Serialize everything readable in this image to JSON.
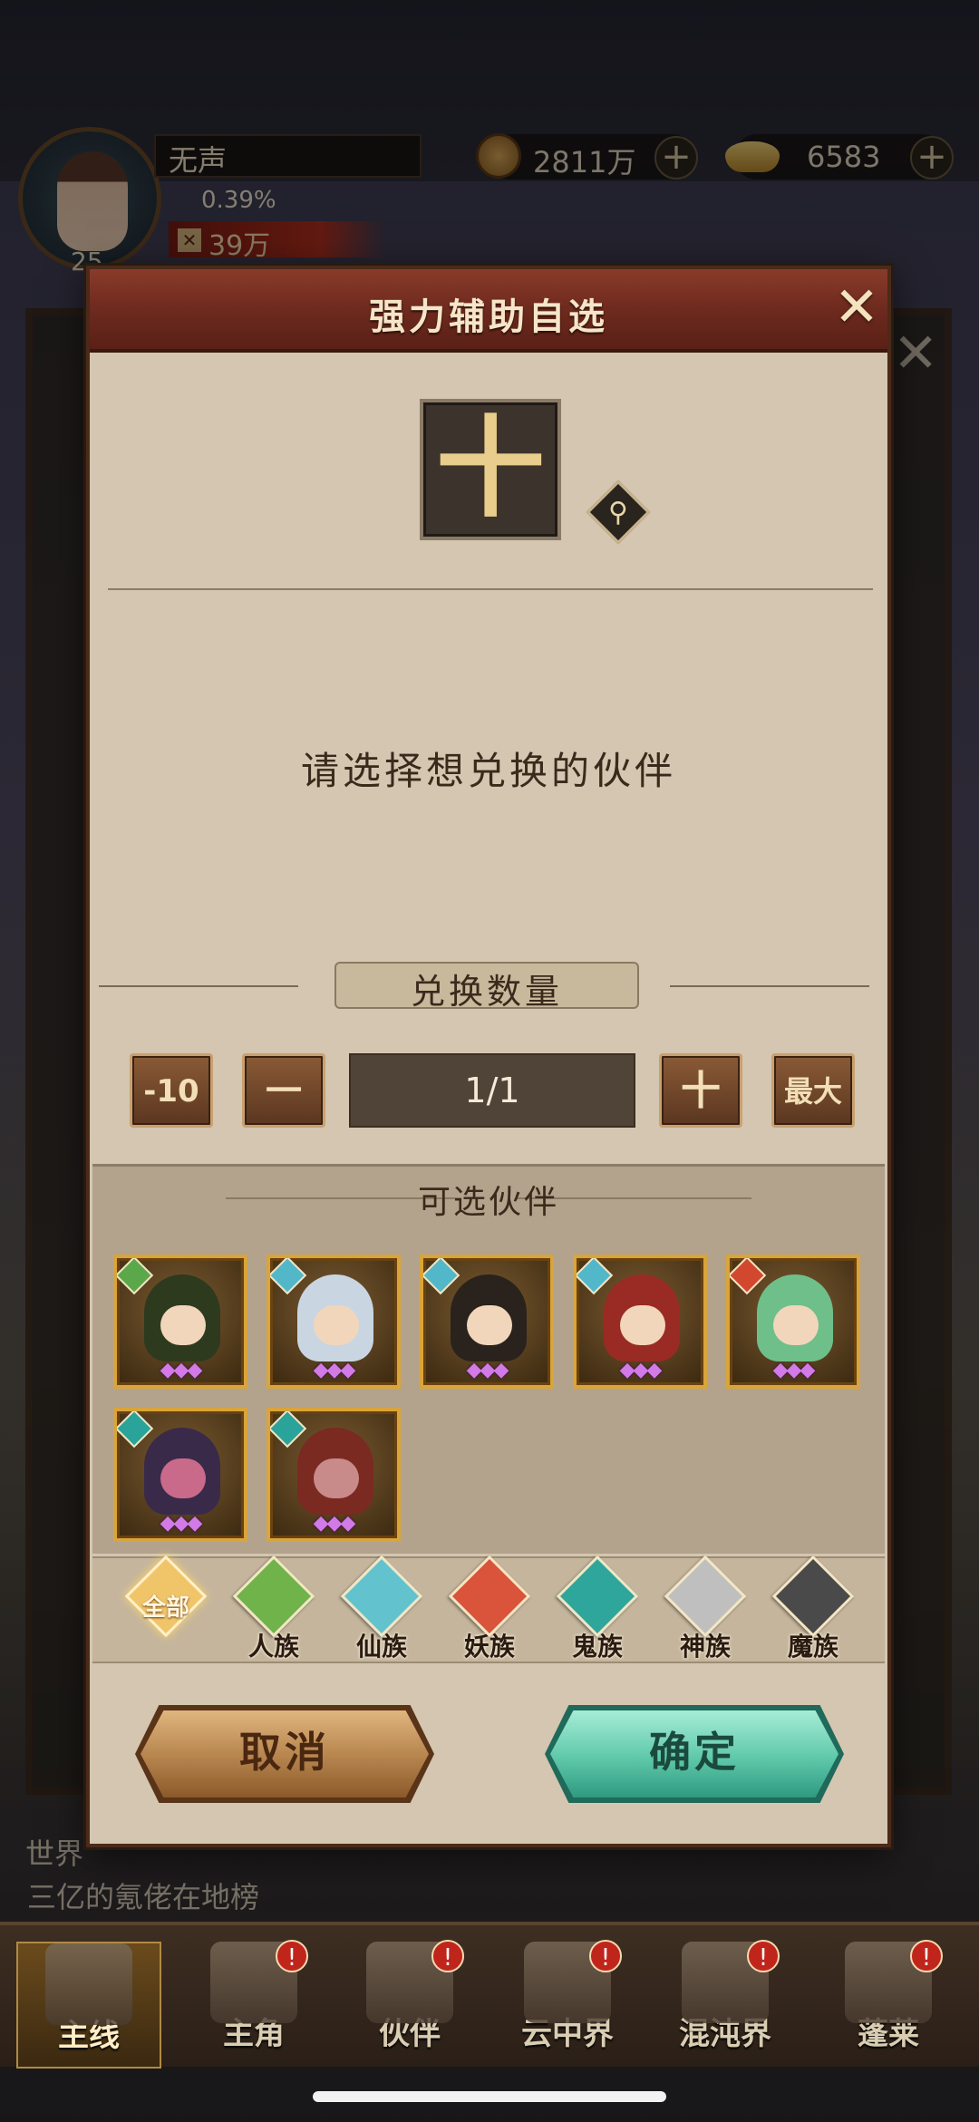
{
  "player": {
    "name": "无声",
    "level": "25",
    "exp_percent": "0.39%",
    "power": "39万"
  },
  "currency": {
    "coins": "2811万",
    "ingots": "6583"
  },
  "chat": {
    "channel": "世界",
    "line2": "三亿的氪佬在地榜"
  },
  "modal": {
    "title": "强力辅助自选",
    "hint": "请选择想兑换的伙伴",
    "quantity_label": "兑换数量",
    "stepper": {
      "minus10": "-10",
      "minus": "一",
      "value": "1/1",
      "plus": "十",
      "max": "最大"
    },
    "partners_title": "可选伙伴",
    "partners": [
      {
        "race": "人族",
        "race_color": "#5aa84a",
        "stars": "◆◆◆"
      },
      {
        "race": "仙族",
        "race_color": "#52b7c9",
        "stars": "◆◆◆"
      },
      {
        "race": "仙族",
        "race_color": "#52b7c9",
        "stars": "◆◆◆"
      },
      {
        "race": "仙族",
        "race_color": "#52b7c9",
        "stars": "◆◆◆"
      },
      {
        "race": "妖族",
        "race_color": "#d2482e",
        "stars": "◆◆◆"
      },
      {
        "race": "鬼族",
        "race_color": "#2aa39a",
        "stars": "◆◆◆"
      },
      {
        "race": "鬼族",
        "race_color": "#2aa39a",
        "stars": "◆◆◆"
      }
    ],
    "filters": [
      {
        "label": "全部",
        "color": "#f0c56a"
      },
      {
        "label": "人族",
        "color": "#6fb34a"
      },
      {
        "label": "仙族",
        "color": "#62c3cf"
      },
      {
        "label": "妖族",
        "color": "#d9543a"
      },
      {
        "label": "鬼族",
        "color": "#2fa69c"
      },
      {
        "label": "神族",
        "color": "#bfbfbf"
      },
      {
        "label": "魔族",
        "color": "#4a4a4a"
      }
    ],
    "cancel_label": "取消",
    "confirm_label": "确定"
  },
  "nav": [
    {
      "label": "主线",
      "badge": ""
    },
    {
      "label": "主角",
      "badge": "!"
    },
    {
      "label": "伙伴",
      "badge": "!"
    },
    {
      "label": "云中界",
      "badge": "!"
    },
    {
      "label": "混沌界",
      "badge": "!"
    },
    {
      "label": "蓬莱",
      "badge": "!"
    }
  ]
}
